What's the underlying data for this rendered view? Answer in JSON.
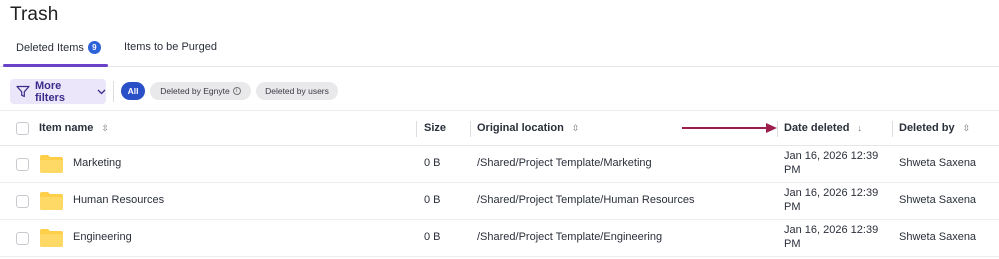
{
  "page": {
    "title": "Trash"
  },
  "tabs": [
    {
      "label": "Deleted Items",
      "badge": "9",
      "active": true
    },
    {
      "label": "Items to be Purged",
      "active": false
    }
  ],
  "filters": {
    "more_filters_label": "More filters",
    "chips": [
      {
        "label": "All",
        "selected": true
      },
      {
        "label": "Deleted by Egnyte",
        "selected": false
      },
      {
        "label": "Deleted by users",
        "selected": false
      }
    ]
  },
  "table": {
    "columns": {
      "name": "Item name",
      "size": "Size",
      "location": "Original location",
      "date": "Date deleted",
      "by": "Deleted by"
    },
    "rows": [
      {
        "name": "Marketing",
        "size": "0 B",
        "location": "/Shared/Project Template/Marketing",
        "date_line1": "Jan 16, 2026 12:39",
        "date_line2": "PM",
        "by": "Shweta Saxena"
      },
      {
        "name": "Human Resources",
        "size": "0 B",
        "location": "/Shared/Project Template/Human Resources",
        "date_line1": "Jan 16, 2026 12:39",
        "date_line2": "PM",
        "by": "Shweta Saxena"
      },
      {
        "name": "Engineering",
        "size": "0 B",
        "location": "/Shared/Project Template/Engineering",
        "date_line1": "Jan 16, 2026 12:39",
        "date_line2": "PM",
        "by": "Shweta Saxena"
      }
    ]
  },
  "colors": {
    "accent": "#6a42c8",
    "badge": "#2d63d8",
    "annotation_arrow": "#9a1f4f",
    "folder": "#ffcf4a"
  },
  "icons": {
    "filter": "filter-icon",
    "chevron": "chevron-down-icon",
    "sort": "sort-icon",
    "folder": "folder-icon",
    "info": "info-icon"
  }
}
